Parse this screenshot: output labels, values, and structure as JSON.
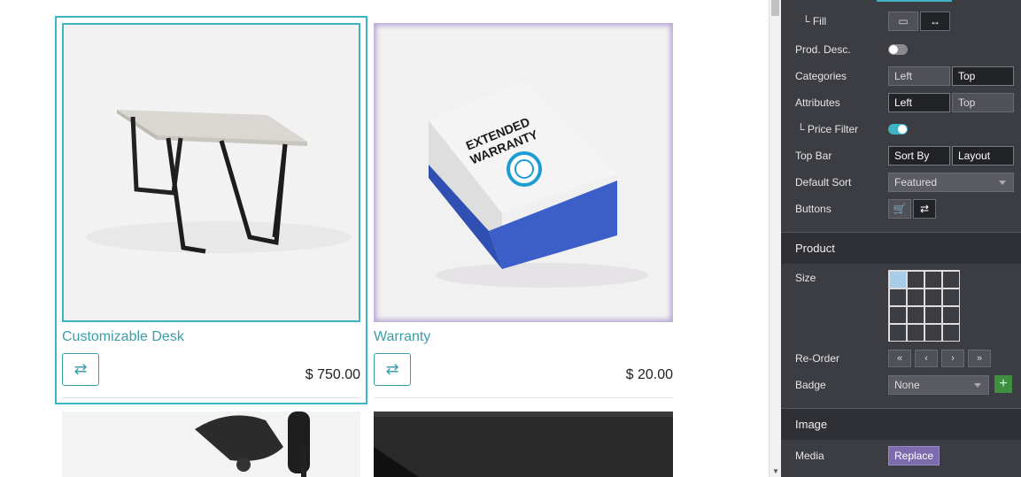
{
  "products": [
    {
      "name": "Customizable Desk",
      "price": "$ 750.00"
    },
    {
      "name": "Warranty",
      "price": "$ 20.00"
    }
  ],
  "warranty_box": {
    "line1": "EXTENDED",
    "line2": "WARRANTY"
  },
  "panel": {
    "fill_label": "└ Fill",
    "prod_desc_label": "Prod. Desc.",
    "categories_label": "Categories",
    "categories_options": [
      "Left",
      "Top"
    ],
    "attributes_label": "Attributes",
    "attributes_options": [
      "Left",
      "Top"
    ],
    "price_filter_label": "└ Price Filter",
    "top_bar_label": "Top Bar",
    "top_bar_options": [
      "Sort By",
      "Layout"
    ],
    "default_sort_label": "Default Sort",
    "default_sort_value": "Featured",
    "buttons_label": "Buttons",
    "product_section": "Product",
    "size_label": "Size",
    "reorder_label": "Re-Order",
    "reorder_buttons": [
      "«",
      "‹",
      "›",
      "»"
    ],
    "badge_label": "Badge",
    "badge_value": "None",
    "image_section": "Image",
    "media_label": "Media",
    "replace_label": "Replace"
  },
  "colors": {
    "accent": "#3fb3c2",
    "panel_bg": "#3c3d43",
    "replace_bg": "#7c6bad"
  }
}
